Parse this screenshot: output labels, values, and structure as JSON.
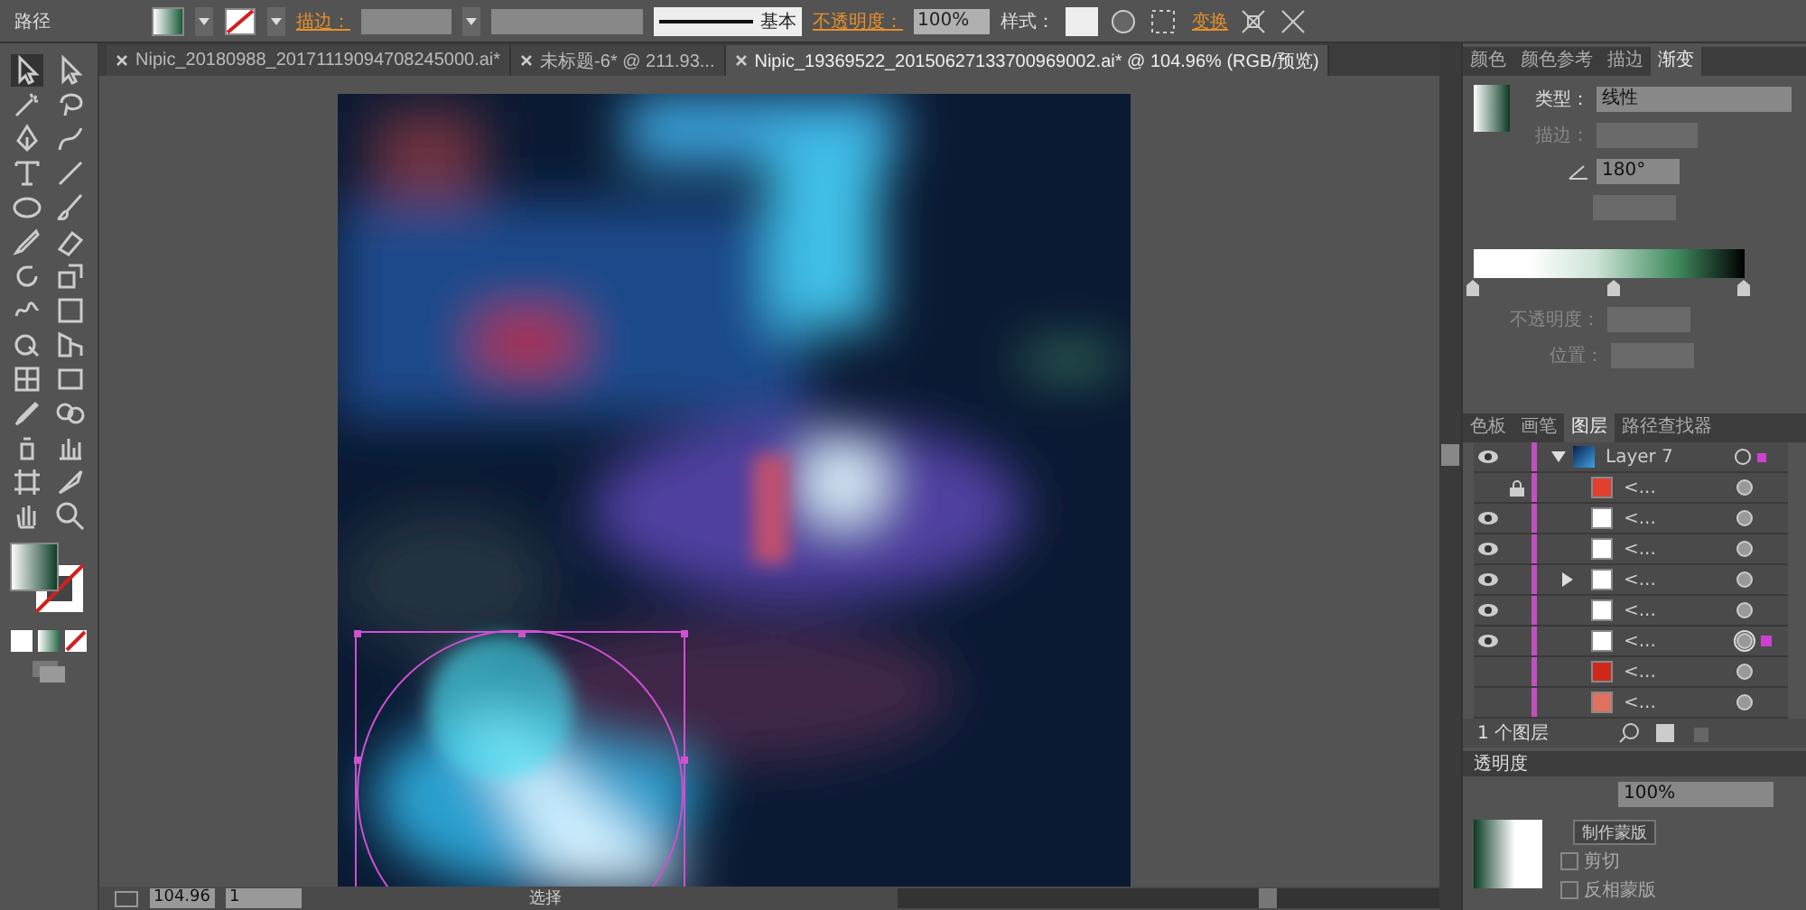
{
  "control_bar": {
    "selection": "路径",
    "stroke_label": "描边：",
    "stroke_profile": "基本",
    "opacity_label": "不透明度：",
    "opacity": "100%",
    "style_label": "样式：",
    "transform_link": "变换"
  },
  "doc_tabs": [
    {
      "title": "Nipic_20180988_20171119094708245000.ai*",
      "selected": false
    },
    {
      "title": "未标题-6* @ 211.93...",
      "selected": false
    },
    {
      "title": "Nipic_19369522_20150627133700969002.ai* @ 104.96% (RGB/预览)",
      "selected": true
    }
  ],
  "gradient_panel": {
    "tabs": [
      {
        "label": "颜色",
        "selected": false
      },
      {
        "label": "颜色参考",
        "selected": false
      },
      {
        "label": "描边",
        "selected": false
      },
      {
        "label": "渐变",
        "selected": true
      }
    ],
    "type_label": "类型：",
    "type": "线性",
    "stroke_label": "描边：",
    "angle": "180°",
    "opacity_label": "不透明度：",
    "position_label": "位置："
  },
  "layers_panel": {
    "tabs": [
      {
        "label": "色板",
        "selected": false
      },
      {
        "label": "画笔",
        "selected": false
      },
      {
        "label": "图层",
        "selected": true
      },
      {
        "label": "路径查找器",
        "selected": false
      }
    ],
    "layer": {
      "name": "Layer 7",
      "visible": true,
      "expanded": true,
      "selected": true,
      "children": [
        {
          "name": "<...",
          "visible": false,
          "locked": true,
          "has_children": false,
          "selected": false
        },
        {
          "name": "<...",
          "visible": true,
          "locked": false,
          "has_children": false,
          "selected": false
        },
        {
          "name": "<...",
          "visible": true,
          "locked": false,
          "has_children": false,
          "selected": false
        },
        {
          "name": "<...",
          "visible": true,
          "locked": false,
          "has_children": true,
          "selected": false
        },
        {
          "name": "<...",
          "visible": true,
          "locked": false,
          "has_children": false,
          "selected": false
        },
        {
          "name": "<...",
          "visible": true,
          "locked": false,
          "has_children": false,
          "selected": true
        },
        {
          "name": "<...",
          "visible": false,
          "locked": false,
          "has_children": false,
          "selected": false
        },
        {
          "name": "<...",
          "visible": false,
          "locked": false,
          "has_children": false,
          "selected": false
        }
      ]
    },
    "count": "1 个图层"
  },
  "transparency_panel": {
    "title": "透明度",
    "opacity": "100%",
    "mask_button": "制作蒙版",
    "options": [
      {
        "label": "剪切",
        "checked": false
      },
      {
        "label": "反相蒙版",
        "checked": false
      }
    ]
  },
  "status_bar": {
    "zoom": "104.96",
    "page": "1",
    "tool": "选择"
  }
}
